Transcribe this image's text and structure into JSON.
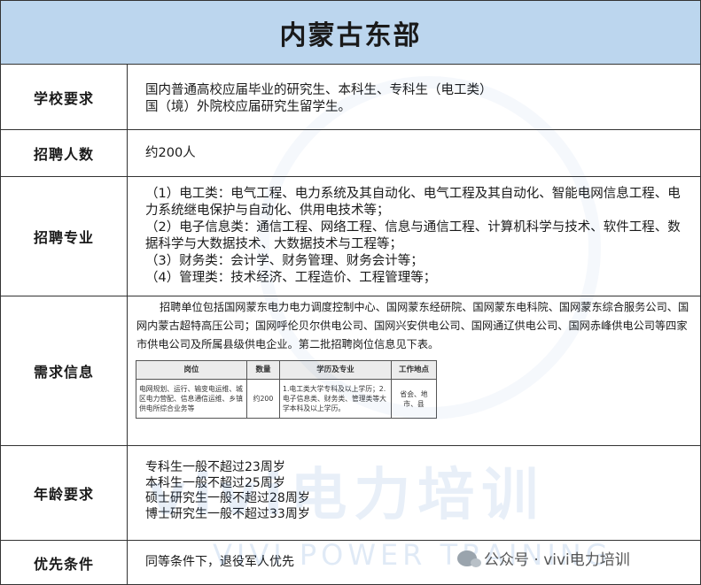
{
  "title": "内蒙古东部",
  "rows": {
    "school": {
      "label": "学校要求",
      "lines": [
        "国内普通高校应届毕业的研究生、本科生、专科生（电工类）",
        "国（境）外院校应届研究生留学生。"
      ]
    },
    "count": {
      "label": "招聘人数",
      "value": "约200人"
    },
    "major": {
      "label": "招聘专业",
      "items": [
        "（1）电工类：电气工程、电力系统及其自动化、电气工程及其自动化、智能电网信息工程、电力系统继电保护与自动化、供用电技术等；",
        "（2）电子信息类：通信工程、网络工程、信息与通信工程、计算机科学与技术、软件工程、数据科学与大数据技术、大数据技术与工程等；",
        "（3）财务类：会计学、财务管理、财务会计等；",
        "（4）管理类：技术经济、工程造价、工程管理等；"
      ]
    },
    "demand": {
      "label": "需求信息",
      "intro": "招聘单位包括国网蒙东电力电力调度控制中心、国网蒙东经研院、国网蒙东电科院、国网蒙东综合服务公司、国网内蒙古超特高压公司；国网呼伦贝尔供电公司、国网兴安供电公司、国网通辽供电公司、国网赤峰供电公司等四家市供电公司及所属县级供电企业。第二批招聘岗位信息见下表。",
      "table": {
        "headers": [
          "岗位",
          "数量",
          "学历及专业",
          "工作地点"
        ],
        "row": {
          "position": "电网规划、运行、输变电运维、城区电力营配、信息通信运维、乡镇供电所综合业务等",
          "count": "约200",
          "education": "1.电工类大学专科及以上学历；2.电子信息类、财务类、管理类等大学本科及以上学历。",
          "location": "省会、地市、县"
        }
      }
    },
    "age": {
      "label": "年龄要求",
      "lines": [
        "专科生一般不超过23周岁",
        "本科生一般不超过25周岁",
        "硕士研究生一般不超过28周岁",
        "博士研究生一般不超过33周岁"
      ]
    },
    "priority": {
      "label": "优先条件",
      "value": "同等条件下，退役军人优先"
    }
  },
  "watermark": {
    "brand_text": "公众号 · vivi电力培训",
    "large_cn": "vivi电力培训",
    "large_en": "VIVI POWER TRAINING",
    "color": "#0b58b8"
  },
  "colors": {
    "title_bg": "#bcd6ee",
    "border": "#333333"
  }
}
